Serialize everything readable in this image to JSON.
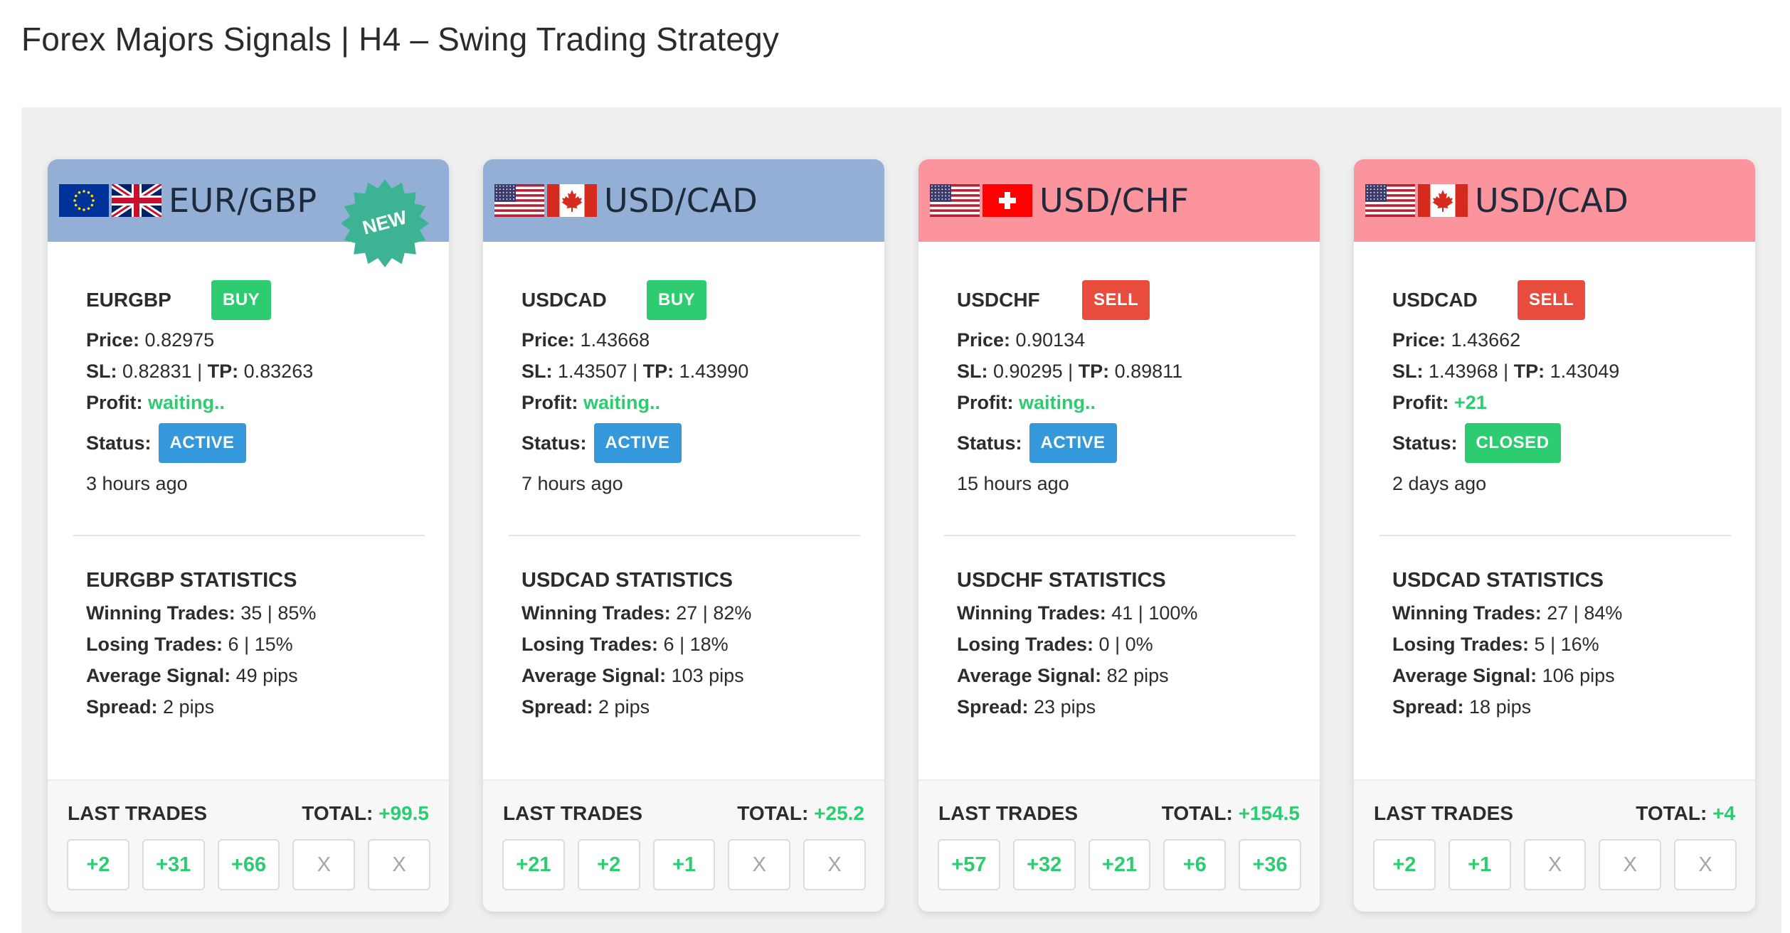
{
  "page": {
    "title": "Forex Majors Signals | H4 – Swing Trading Strategy"
  },
  "colors": {
    "buy_header": "#94afd6",
    "sell_header": "#fb949c",
    "green": "#2ecc71",
    "red": "#e74c3c",
    "blue": "#3498db",
    "new_badge": "#3cb493"
  },
  "cards": [
    {
      "flags": [
        "eu-flag",
        "uk-flag"
      ],
      "pair": "EUR/GBP",
      "badge": "NEW",
      "symbol": "EURGBP",
      "direction": "BUY",
      "price_label": "Price:",
      "price": " 0.82975",
      "sl_label": "SL:",
      "sl": " 0.82831 | ",
      "tp_label": "TP:",
      "tp": " 0.83263",
      "profit_label": "Profit:",
      "profit": " waiting..",
      "status_label": "Status:",
      "status": "ACTIVE",
      "time_ago": "3 hours ago",
      "stats_title": "EURGBP STATISTICS",
      "winning_label": "Winning Trades:",
      "winning": " 35 | 85%",
      "losing_label": "Losing Trades:",
      "losing": " 6 | 15%",
      "avg_label": "Average Signal:",
      "avg": " 49 pips",
      "spread_label": "Spread:",
      "spread": " 2 pips",
      "last_trades_label": "LAST TRADES",
      "total_label": "TOTAL:",
      "total": " +99.5",
      "trades": [
        "+2",
        "+31",
        "+66",
        "X",
        "X"
      ]
    },
    {
      "flags": [
        "us-flag",
        "ca-flag"
      ],
      "pair": "USD/CAD",
      "symbol": "USDCAD",
      "direction": "BUY",
      "price_label": "Price:",
      "price": " 1.43668",
      "sl_label": "SL:",
      "sl": " 1.43507 | ",
      "tp_label": "TP:",
      "tp": " 1.43990",
      "profit_label": "Profit:",
      "profit": " waiting..",
      "status_label": "Status:",
      "status": "ACTIVE",
      "time_ago": "7 hours ago",
      "stats_title": "USDCAD STATISTICS",
      "winning_label": "Winning Trades:",
      "winning": " 27 | 82%",
      "losing_label": "Losing Trades:",
      "losing": " 6 | 18%",
      "avg_label": "Average Signal:",
      "avg": " 103 pips",
      "spread_label": "Spread:",
      "spread": " 2 pips",
      "last_trades_label": "LAST TRADES",
      "total_label": "TOTAL:",
      "total": " +25.2",
      "trades": [
        "+21",
        "+2",
        "+1",
        "X",
        "X"
      ]
    },
    {
      "flags": [
        "us-flag",
        "ch-flag"
      ],
      "pair": "USD/CHF",
      "symbol": "USDCHF",
      "direction": "SELL",
      "price_label": "Price:",
      "price": " 0.90134",
      "sl_label": "SL:",
      "sl": " 0.90295 | ",
      "tp_label": "TP:",
      "tp": " 0.89811",
      "profit_label": "Profit:",
      "profit": " waiting..",
      "status_label": "Status:",
      "status": "ACTIVE",
      "time_ago": "15 hours ago",
      "stats_title": "USDCHF STATISTICS",
      "winning_label": "Winning Trades:",
      "winning": " 41 | 100%",
      "losing_label": "Losing Trades:",
      "losing": " 0 | 0%",
      "avg_label": "Average Signal:",
      "avg": " 82 pips",
      "spread_label": "Spread:",
      "spread": " 23 pips",
      "last_trades_label": "LAST TRADES",
      "total_label": "TOTAL:",
      "total": " +154.5",
      "trades": [
        "+57",
        "+32",
        "+21",
        "+6",
        "+36"
      ]
    },
    {
      "flags": [
        "us-flag",
        "ca-flag"
      ],
      "pair": "USD/CAD",
      "symbol": "USDCAD",
      "direction": "SELL",
      "price_label": "Price:",
      "price": " 1.43662",
      "sl_label": "SL:",
      "sl": " 1.43968 | ",
      "tp_label": "TP:",
      "tp": " 1.43049",
      "profit_label": "Profit:",
      "profit": " +21",
      "status_label": "Status:",
      "status": "CLOSED",
      "time_ago": "2 days ago",
      "stats_title": "USDCAD STATISTICS",
      "winning_label": "Winning Trades:",
      "winning": " 27 | 84%",
      "losing_label": "Losing Trades:",
      "losing": " 5 | 16%",
      "avg_label": "Average Signal:",
      "avg": " 106 pips",
      "spread_label": "Spread:",
      "spread": " 18 pips",
      "last_trades_label": "LAST TRADES",
      "total_label": "TOTAL:",
      "total": " +4",
      "trades": [
        "+2",
        "+1",
        "X",
        "X",
        "X"
      ]
    }
  ]
}
